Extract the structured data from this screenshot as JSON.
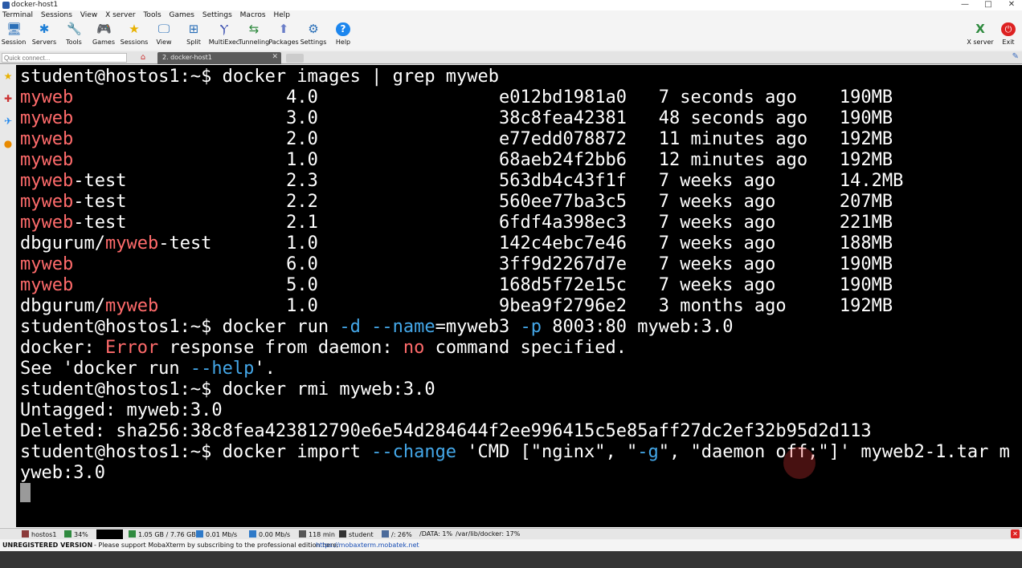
{
  "window": {
    "title": "docker-host1",
    "ctl_min": "—",
    "ctl_max": "□",
    "ctl_close": "✕"
  },
  "menu": [
    "Terminal",
    "Sessions",
    "View",
    "X server",
    "Tools",
    "Games",
    "Settings",
    "Macros",
    "Help"
  ],
  "toolbar": {
    "items": [
      {
        "label": "Session",
        "icon": "session-icon",
        "glyph": "🖥"
      },
      {
        "label": "Servers",
        "icon": "servers-icon",
        "glyph": "✱"
      },
      {
        "label": "Tools",
        "icon": "tools-icon",
        "glyph": "🔧"
      },
      {
        "label": "Games",
        "icon": "games-icon",
        "glyph": "🎮"
      },
      {
        "label": "Sessions",
        "icon": "sessions-star-icon",
        "glyph": "★"
      },
      {
        "label": "View",
        "icon": "view-icon",
        "glyph": "🖵"
      },
      {
        "label": "Split",
        "icon": "split-icon",
        "glyph": "⊞"
      },
      {
        "label": "MultiExec",
        "icon": "multiexec-icon",
        "glyph": "Ⲩ"
      },
      {
        "label": "Tunneling",
        "icon": "tunneling-icon",
        "glyph": "⇆"
      },
      {
        "label": "Packages",
        "icon": "packages-icon",
        "glyph": "⬆"
      },
      {
        "label": "Settings",
        "icon": "settings-icon",
        "glyph": "⚙"
      },
      {
        "label": "Help",
        "icon": "help-icon",
        "glyph": "?"
      }
    ],
    "xserver": {
      "label": "X server",
      "glyph": "X"
    },
    "exit": {
      "label": "Exit",
      "glyph": "⏻"
    }
  },
  "tabs": {
    "quick_connect_placeholder": "Quick connect...",
    "active_tab": "2. docker-host1",
    "close_glyph": "✕",
    "home_glyph": "⌂"
  },
  "terminal": {
    "lines": [
      [
        {
          "t": "student@hostos1:~$ docker images | grep myweb",
          "c": ""
        }
      ],
      [
        {
          "t": "myweb",
          "c": "red"
        },
        {
          "t": "                    4.0                 e012bd1981a0   7 seconds ago    190MB",
          "c": ""
        }
      ],
      [
        {
          "t": "myweb",
          "c": "red"
        },
        {
          "t": "                    3.0                 38c8fea42381   48 seconds ago   190MB",
          "c": ""
        }
      ],
      [
        {
          "t": "myweb",
          "c": "red"
        },
        {
          "t": "                    2.0                 e77edd078872   11 minutes ago   192MB",
          "c": ""
        }
      ],
      [
        {
          "t": "myweb",
          "c": "red"
        },
        {
          "t": "                    1.0                 68aeb24f2bb6   12 minutes ago   192MB",
          "c": ""
        }
      ],
      [
        {
          "t": "myweb",
          "c": "red"
        },
        {
          "t": "-test               2.3                 563db4c43f1f   7 weeks ago      14.2MB",
          "c": ""
        }
      ],
      [
        {
          "t": "myweb",
          "c": "red"
        },
        {
          "t": "-test               2.2                 560ee77ba3c5   7 weeks ago      207MB",
          "c": ""
        }
      ],
      [
        {
          "t": "myweb",
          "c": "red"
        },
        {
          "t": "-test               2.1                 6fdf4a398ec3   7 weeks ago      221MB",
          "c": ""
        }
      ],
      [
        {
          "t": "dbgurum/",
          "c": ""
        },
        {
          "t": "myweb",
          "c": "red"
        },
        {
          "t": "-test       1.0                 142c4ebc7e46   7 weeks ago      188MB",
          "c": ""
        }
      ],
      [
        {
          "t": "myweb",
          "c": "red"
        },
        {
          "t": "                    6.0                 3ff9d2267d7e   7 weeks ago      190MB",
          "c": ""
        }
      ],
      [
        {
          "t": "myweb",
          "c": "red"
        },
        {
          "t": "                    5.0                 168d5f72e15c   7 weeks ago      190MB",
          "c": ""
        }
      ],
      [
        {
          "t": "dbgurum/",
          "c": ""
        },
        {
          "t": "myweb",
          "c": "red"
        },
        {
          "t": "            1.0                 9bea9f2796e2   3 months ago     192MB",
          "c": ""
        }
      ],
      [
        {
          "t": "student@hostos1:~$ docker run ",
          "c": ""
        },
        {
          "t": "-d --name",
          "c": "blue"
        },
        {
          "t": "=myweb3 ",
          "c": ""
        },
        {
          "t": "-p",
          "c": "blue"
        },
        {
          "t": " 8003:80 myweb:3.0",
          "c": ""
        }
      ],
      [
        {
          "t": "docker: ",
          "c": ""
        },
        {
          "t": "Error",
          "c": "red"
        },
        {
          "t": " response from daemon: ",
          "c": ""
        },
        {
          "t": "no",
          "c": "red"
        },
        {
          "t": " command specified.",
          "c": ""
        }
      ],
      [
        {
          "t": "See 'docker run ",
          "c": ""
        },
        {
          "t": "--help",
          "c": "blue"
        },
        {
          "t": "'.",
          "c": ""
        }
      ],
      [
        {
          "t": "student@hostos1:~$ docker rmi myweb:3.0",
          "c": ""
        }
      ],
      [
        {
          "t": "Untagged: myweb:3.0",
          "c": ""
        }
      ],
      [
        {
          "t": "Deleted: sha256:38c8fea423812790e6e54d284644f2ee996415c5e85aff27dc2ef32b95d2d113",
          "c": ""
        }
      ],
      [
        {
          "t": "student@hostos1:~$ docker import ",
          "c": ""
        },
        {
          "t": "--change",
          "c": "blue"
        },
        {
          "t": " 'CMD [\"nginx\", \"",
          "c": ""
        },
        {
          "t": "-g",
          "c": "blue"
        },
        {
          "t": "\", \"daemon off;\"]' myweb2-1.tar m",
          "c": ""
        }
      ],
      [
        {
          "t": "yweb:3.0",
          "c": ""
        }
      ]
    ]
  },
  "status": {
    "host": "hostos1",
    "cpu": "34%",
    "memory": "1.05 GB / 7.76 GB",
    "upload": "0.01 Mb/s",
    "download": "0.00 Mb/s",
    "uptime": "118 min",
    "user": "student",
    "disk": "/: 26%",
    "data": "/DATA: 1%",
    "docker": "/var/lib/docker: 17%"
  },
  "footer": {
    "unregistered": "UNREGISTERED VERSION",
    "message": "-  Please support MobaXterm by subscribing to the professional edition here:",
    "link": "https://mobaxterm.mobatek.net"
  },
  "colors": {
    "terminal_bg": "#000000",
    "prompt_text": "#ffffff",
    "highlight_red": "#ff6b6b",
    "option_blue": "#44a7e8"
  }
}
